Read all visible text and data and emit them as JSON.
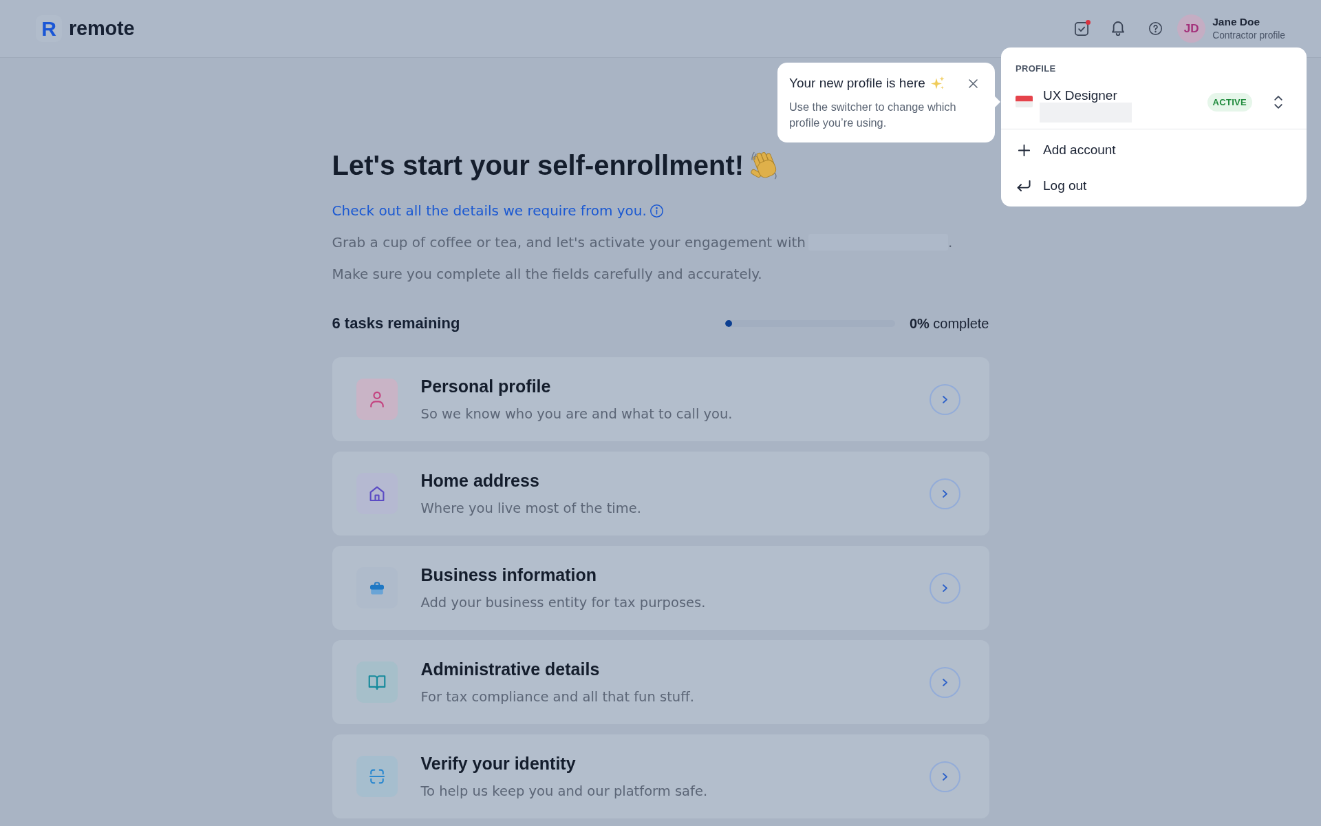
{
  "header": {
    "logo_mark": "R",
    "logo_text": "remote",
    "tasks_notification": true,
    "user": {
      "initials": "JD",
      "name": "Jane Doe",
      "role": "Contractor profile"
    }
  },
  "tooltip": {
    "title": "Your new profile is here",
    "body": "Use the switcher to change which profile you’re using."
  },
  "profile_menu": {
    "section_label": "PROFILE",
    "profile": {
      "name": "UX Designer",
      "detail_redacted": true,
      "status": "ACTIVE"
    },
    "actions": [
      {
        "kind": "add",
        "label": "Add account"
      },
      {
        "kind": "logout",
        "label": "Log out"
      }
    ]
  },
  "main": {
    "title": "Let's start your self-enrollment!",
    "link": "Check out all the details we require from you.",
    "intro": {
      "text": "Grab a cup of coffee or tea, and let's activate your engagement with",
      "redacted": true,
      "end": "."
    },
    "note": "Make sure you complete all the fields carefully and accurately.",
    "progress": {
      "remaining": "6 tasks remaining",
      "level": 0,
      "reading": "**0%** complete"
    },
    "tasks": [
      {
        "kind": "person",
        "title": "Personal profile",
        "description": "So we know who you are and what to call you."
      },
      {
        "kind": "house",
        "title": "Home address",
        "description": "Where you live most of the time."
      },
      {
        "kind": "briefcase",
        "title": "Business information",
        "description": "Add your business entity for tax purposes."
      },
      {
        "kind": "book",
        "title": "Administrative details",
        "description": "For tax compliance and all that fun stuff."
      },
      {
        "kind": "scan",
        "title": "Verify your identity",
        "description": "To help us keep you and our platform safe."
      }
    ]
  }
}
